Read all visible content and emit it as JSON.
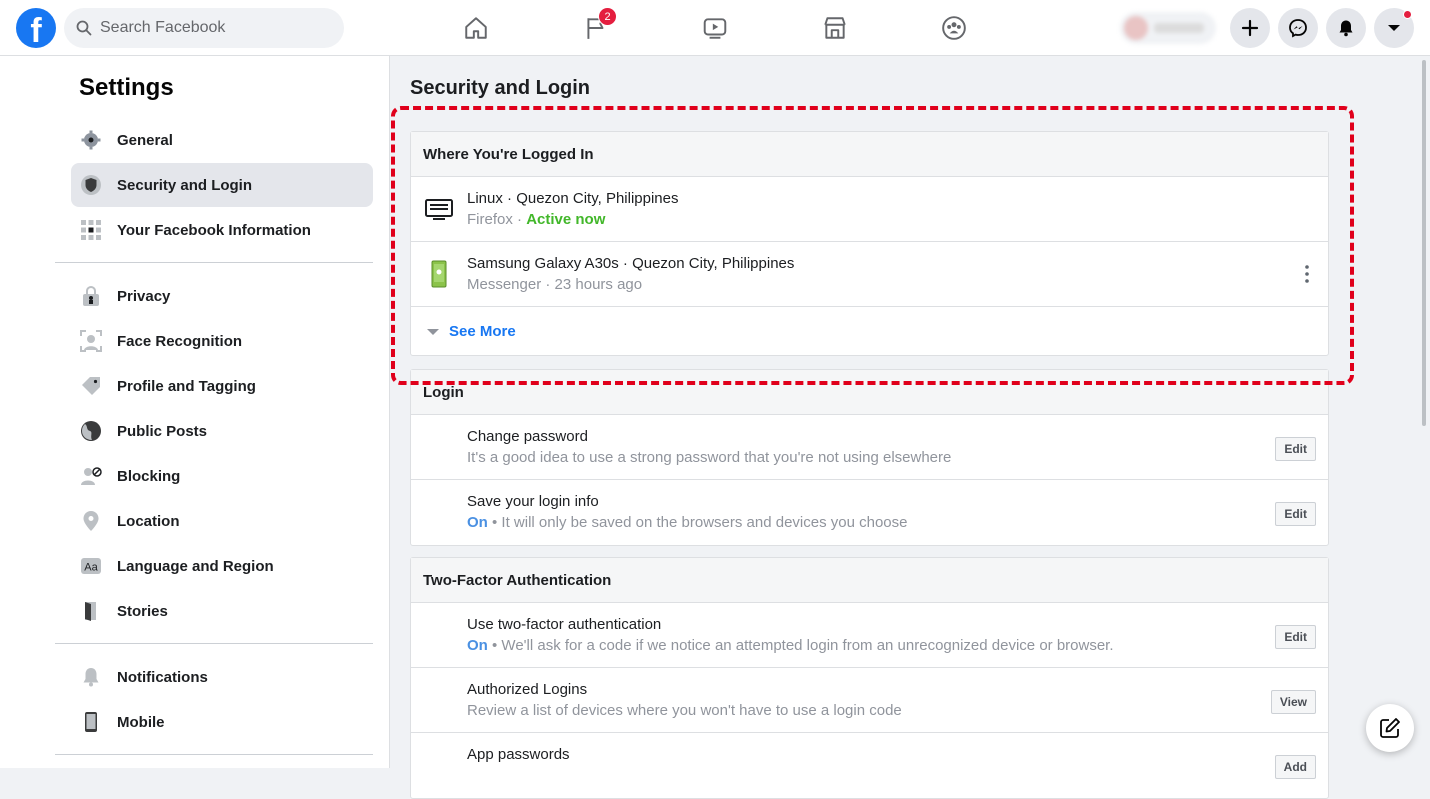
{
  "topbar": {
    "logo_glyph": "f",
    "search_placeholder": "Search Facebook",
    "nav": [
      {
        "name": "home-icon"
      },
      {
        "name": "pages-flag-icon",
        "badge": "2"
      },
      {
        "name": "watch-video-icon"
      },
      {
        "name": "marketplace-icon"
      },
      {
        "name": "groups-icon"
      }
    ],
    "actions": [
      "plus-icon",
      "messenger-icon",
      "bell-icon",
      "account-dropdown-icon"
    ]
  },
  "sidebar": {
    "title": "Settings",
    "groups": [
      [
        {
          "label": "General",
          "icon": "gear-icon"
        },
        {
          "label": "Security and Login",
          "icon": "shield-icon",
          "active": true
        },
        {
          "label": "Your Facebook Information",
          "icon": "grid-icon"
        }
      ],
      [
        {
          "label": "Privacy",
          "icon": "lock-person-icon"
        },
        {
          "label": "Face Recognition",
          "icon": "face-icon"
        },
        {
          "label": "Profile and Tagging",
          "icon": "tag-icon"
        },
        {
          "label": "Public Posts",
          "icon": "globe-icon"
        },
        {
          "label": "Blocking",
          "icon": "block-user-icon"
        },
        {
          "label": "Location",
          "icon": "location-pin-icon"
        },
        {
          "label": "Language and Region",
          "icon": "language-icon"
        },
        {
          "label": "Stories",
          "icon": "book-icon"
        }
      ],
      [
        {
          "label": "Notifications",
          "icon": "bell-icon"
        },
        {
          "label": "Mobile",
          "icon": "phone-icon"
        }
      ]
    ]
  },
  "main": {
    "title": "Security and Login",
    "logged_in": {
      "header": "Where You're Logged In",
      "sessions": [
        {
          "device": "Linux · Quezon City, Philippines",
          "app": "Firefox",
          "sep": " · ",
          "status": "Active now",
          "status_type": "active",
          "icon": "desktop-icon"
        },
        {
          "device": "Samsung Galaxy A30s · Quezon City, Philippines",
          "app": "Messenger",
          "sep": " · ",
          "status": "23 hours ago",
          "status_type": "time",
          "icon": "mobile-device-icon"
        }
      ],
      "see_more": "See More"
    },
    "login": {
      "header": "Login",
      "rows": [
        {
          "title": "Change password",
          "desc": "It's a good idea to use a strong password that you're not using elsewhere",
          "button": "Edit"
        },
        {
          "title": "Save your login info",
          "state": "On",
          "desc": " • It will only be saved on the browsers and devices you choose",
          "button": "Edit"
        }
      ]
    },
    "two_factor": {
      "header": "Two-Factor Authentication",
      "rows": [
        {
          "title": "Use two-factor authentication",
          "state": "On",
          "desc": " • We'll ask for a code if we notice an attempted login from an unrecognized device or browser.",
          "button": "Edit"
        },
        {
          "title": "Authorized Logins",
          "desc": "Review a list of devices where you won't have to use a login code",
          "button": "View"
        },
        {
          "title": "App passwords",
          "desc": "",
          "button": "Add"
        }
      ]
    }
  },
  "colors": {
    "brand": "#1877f2",
    "active": "#42b72a",
    "on": "#4a90e2",
    "highlight": "#e0001b",
    "badge": "#e41e3f"
  }
}
